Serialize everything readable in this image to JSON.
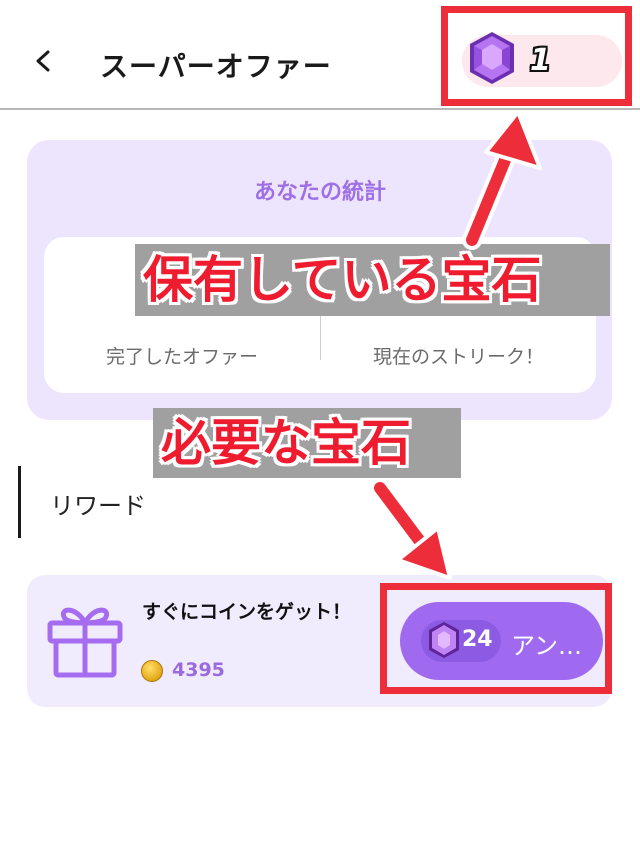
{
  "header": {
    "back_icon": "chevron-left-icon",
    "title": "スーパーオファー",
    "gem_icon": "purple-gem-icon",
    "gem_count": "1"
  },
  "stats": {
    "title": "あなたの統計",
    "labels": [
      "完了したオファー",
      "現在のストリーク！"
    ]
  },
  "annotations": {
    "owned_gems": "保有している宝石",
    "required_gems": "必要な宝石",
    "highlight_color": "#ee2d3a"
  },
  "section": {
    "title": "リワード"
  },
  "reward": {
    "icon": "gift-icon",
    "name": "すぐにコインをゲット！",
    "coin_icon": "coin-icon",
    "coin_amount": "4395",
    "cost": "24",
    "button_label": "アン…"
  },
  "colors": {
    "accent": "#a06af0",
    "card_bg": "#ede5fd"
  }
}
